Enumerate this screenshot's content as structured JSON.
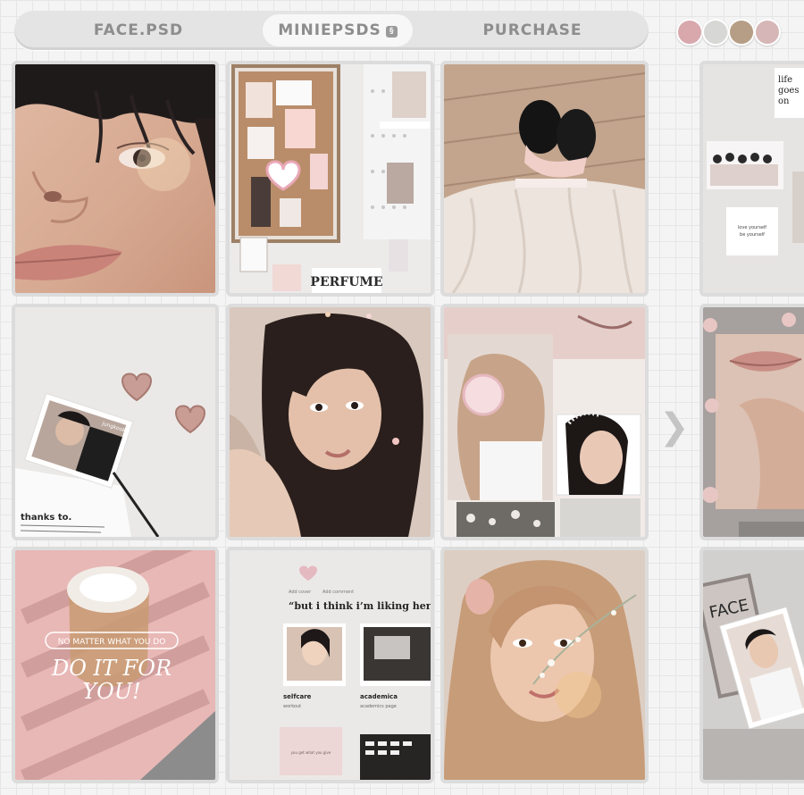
{
  "nav": {
    "items": [
      {
        "label": "FACE.PSD"
      },
      {
        "label": "MINIEPSDS",
        "badge": "§"
      },
      {
        "label": "PURCHASE"
      }
    ]
  },
  "swatches": [
    "#d8a8ad",
    "#d7d7d5",
    "#b69e86",
    "#d6b6b6"
  ],
  "next_arrow": "❯",
  "tiles": {
    "t2": {
      "text": "PERFUME"
    },
    "t4": {
      "line1": "life",
      "line2": "goes",
      "line3": "on",
      "note1": "love yourself",
      "note2": "be yourself"
    },
    "t5": {
      "card_label": "jungkook",
      "heading": "thanks to."
    },
    "t9": {
      "banner": "NO MATTER WHAT YOU DO",
      "line1": "DO IT FOR",
      "line2": "YOU!"
    },
    "t10": {
      "meta1": "Add cover",
      "meta2": "Add comment",
      "quote": "“but i think i’m liking her mor",
      "card1": "selfcare",
      "card1_sub": "workout",
      "card2": "academica",
      "card2_sub": "academics page",
      "bottom": "you get what you give"
    },
    "t12": {
      "title": "FACE"
    }
  }
}
